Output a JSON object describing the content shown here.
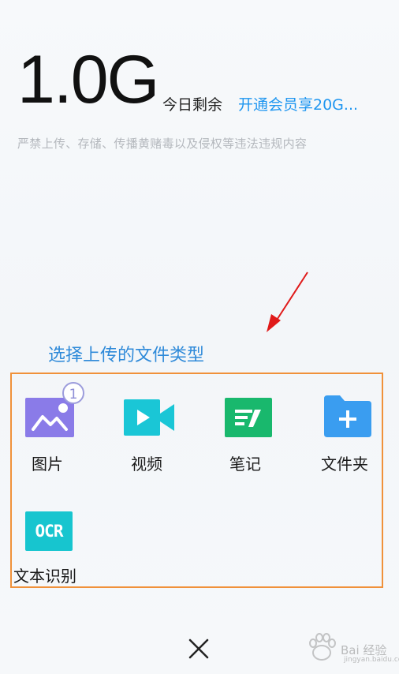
{
  "quota": {
    "size": "1.0G",
    "label": "今日剩余",
    "vip_link": "开通会员享20G..."
  },
  "warning": "严禁上传、存储、传播黄赌毒以及侵权等违法违规内容",
  "annotation": "选择上传的文件类型",
  "items": [
    {
      "label": "图片",
      "icon": "image-icon",
      "color": "#8a7be8",
      "badge": "1"
    },
    {
      "label": "视频",
      "icon": "video-icon",
      "color": "#1ac6d6"
    },
    {
      "label": "笔记",
      "icon": "note-icon",
      "color": "#19b86d"
    },
    {
      "label": "文件夹",
      "icon": "folder-icon",
      "color": "#3a9df0"
    },
    {
      "label": "文本识别",
      "icon": "ocr-icon",
      "color": "#17c5cf",
      "icon_text": "OCR"
    }
  ],
  "close_icon": "close-icon",
  "watermark": {
    "text": "Bai 经验",
    "sub": "jingyan.baidu.com"
  },
  "colors": {
    "accent": "#1f96f0",
    "annotation": "#2f8ad9",
    "annotation_arrow": "#e01a1a",
    "highlight_border": "#f0913a"
  }
}
